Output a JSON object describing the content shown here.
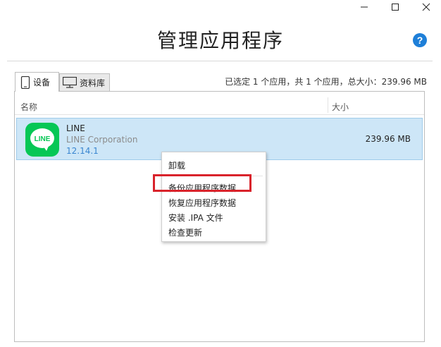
{
  "window": {
    "title": "管理应用程序",
    "minimize_icon": "minimize-icon",
    "maximize_icon": "maximize-icon",
    "close_icon": "close-icon",
    "help_label": "?"
  },
  "tabs": [
    {
      "label": "设备",
      "icon": "phone-icon",
      "selected": true
    },
    {
      "label": "资料库",
      "icon": "monitor-icon",
      "selected": false
    }
  ],
  "summary": "已选定 1 个应用，共 1 个应用，总大小：239.96 MB",
  "table": {
    "columns": [
      "名称",
      "大小"
    ],
    "rows": [
      {
        "icon_text": "LINE",
        "name": "LINE",
        "vendor": "LINE Corporation",
        "version": "12.14.1",
        "size": "239.96 MB",
        "selected": true
      }
    ]
  },
  "context_menu": {
    "items": [
      "卸载",
      "备份应用程序数据",
      "恢复应用程序数据",
      "安装 .IPA 文件",
      "检查更新"
    ],
    "highlighted_item": "备份应用程序数据"
  },
  "colors": {
    "accent_blue": "#1e7fd8",
    "selection": "#cde6f7",
    "line_green": "#06c755",
    "highlight_red": "#d9232b"
  }
}
